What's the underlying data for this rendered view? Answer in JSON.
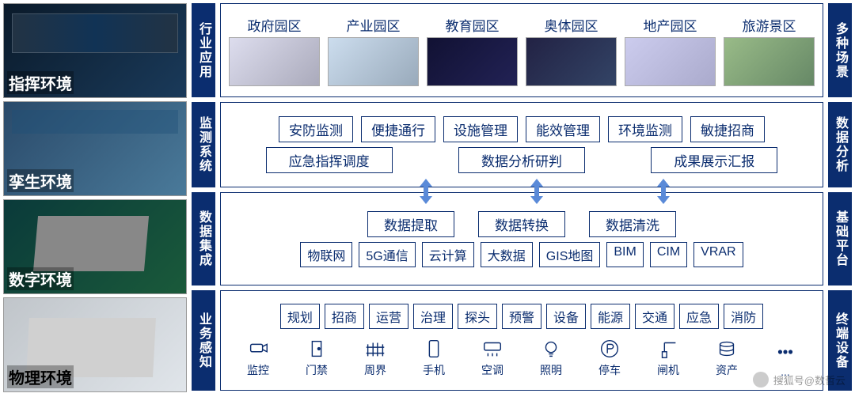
{
  "leftThumbs": [
    "指挥环境",
    "孪生环境",
    "数字环境",
    "物理环境"
  ],
  "leftLabels": [
    "行业应用",
    "监测系统",
    "数据集成",
    "业务感知"
  ],
  "rightLabels": [
    "多种场景",
    "数据分析",
    "基础平台",
    "终端设备"
  ],
  "pane1": [
    "政府园区",
    "产业园区",
    "教育园区",
    "奥体园区",
    "地产园区",
    "旅游景区"
  ],
  "pane2row1": [
    "安防监测",
    "便捷通行",
    "设施管理",
    "能效管理",
    "环境监测",
    "敏捷招商"
  ],
  "pane2row2": [
    "应急指挥调度",
    "数据分析研判",
    "成果展示汇报"
  ],
  "pane3row1": [
    "数据提取",
    "数据转换",
    "数据清洗"
  ],
  "pane3row2": [
    "物联网",
    "5G通信",
    "云计算",
    "大数据",
    "GIS地图",
    "BIM",
    "CIM",
    "VRAR"
  ],
  "pane4row1": [
    "规划",
    "招商",
    "运营",
    "治理",
    "探头",
    "预警",
    "设备",
    "能源",
    "交通",
    "应急",
    "消防"
  ],
  "pane4icons": [
    "监控",
    "门禁",
    "周界",
    "手机",
    "空调",
    "照明",
    "停车",
    "闸机",
    "资产",
    "..."
  ],
  "watermark": "搜狐号@数哲云"
}
